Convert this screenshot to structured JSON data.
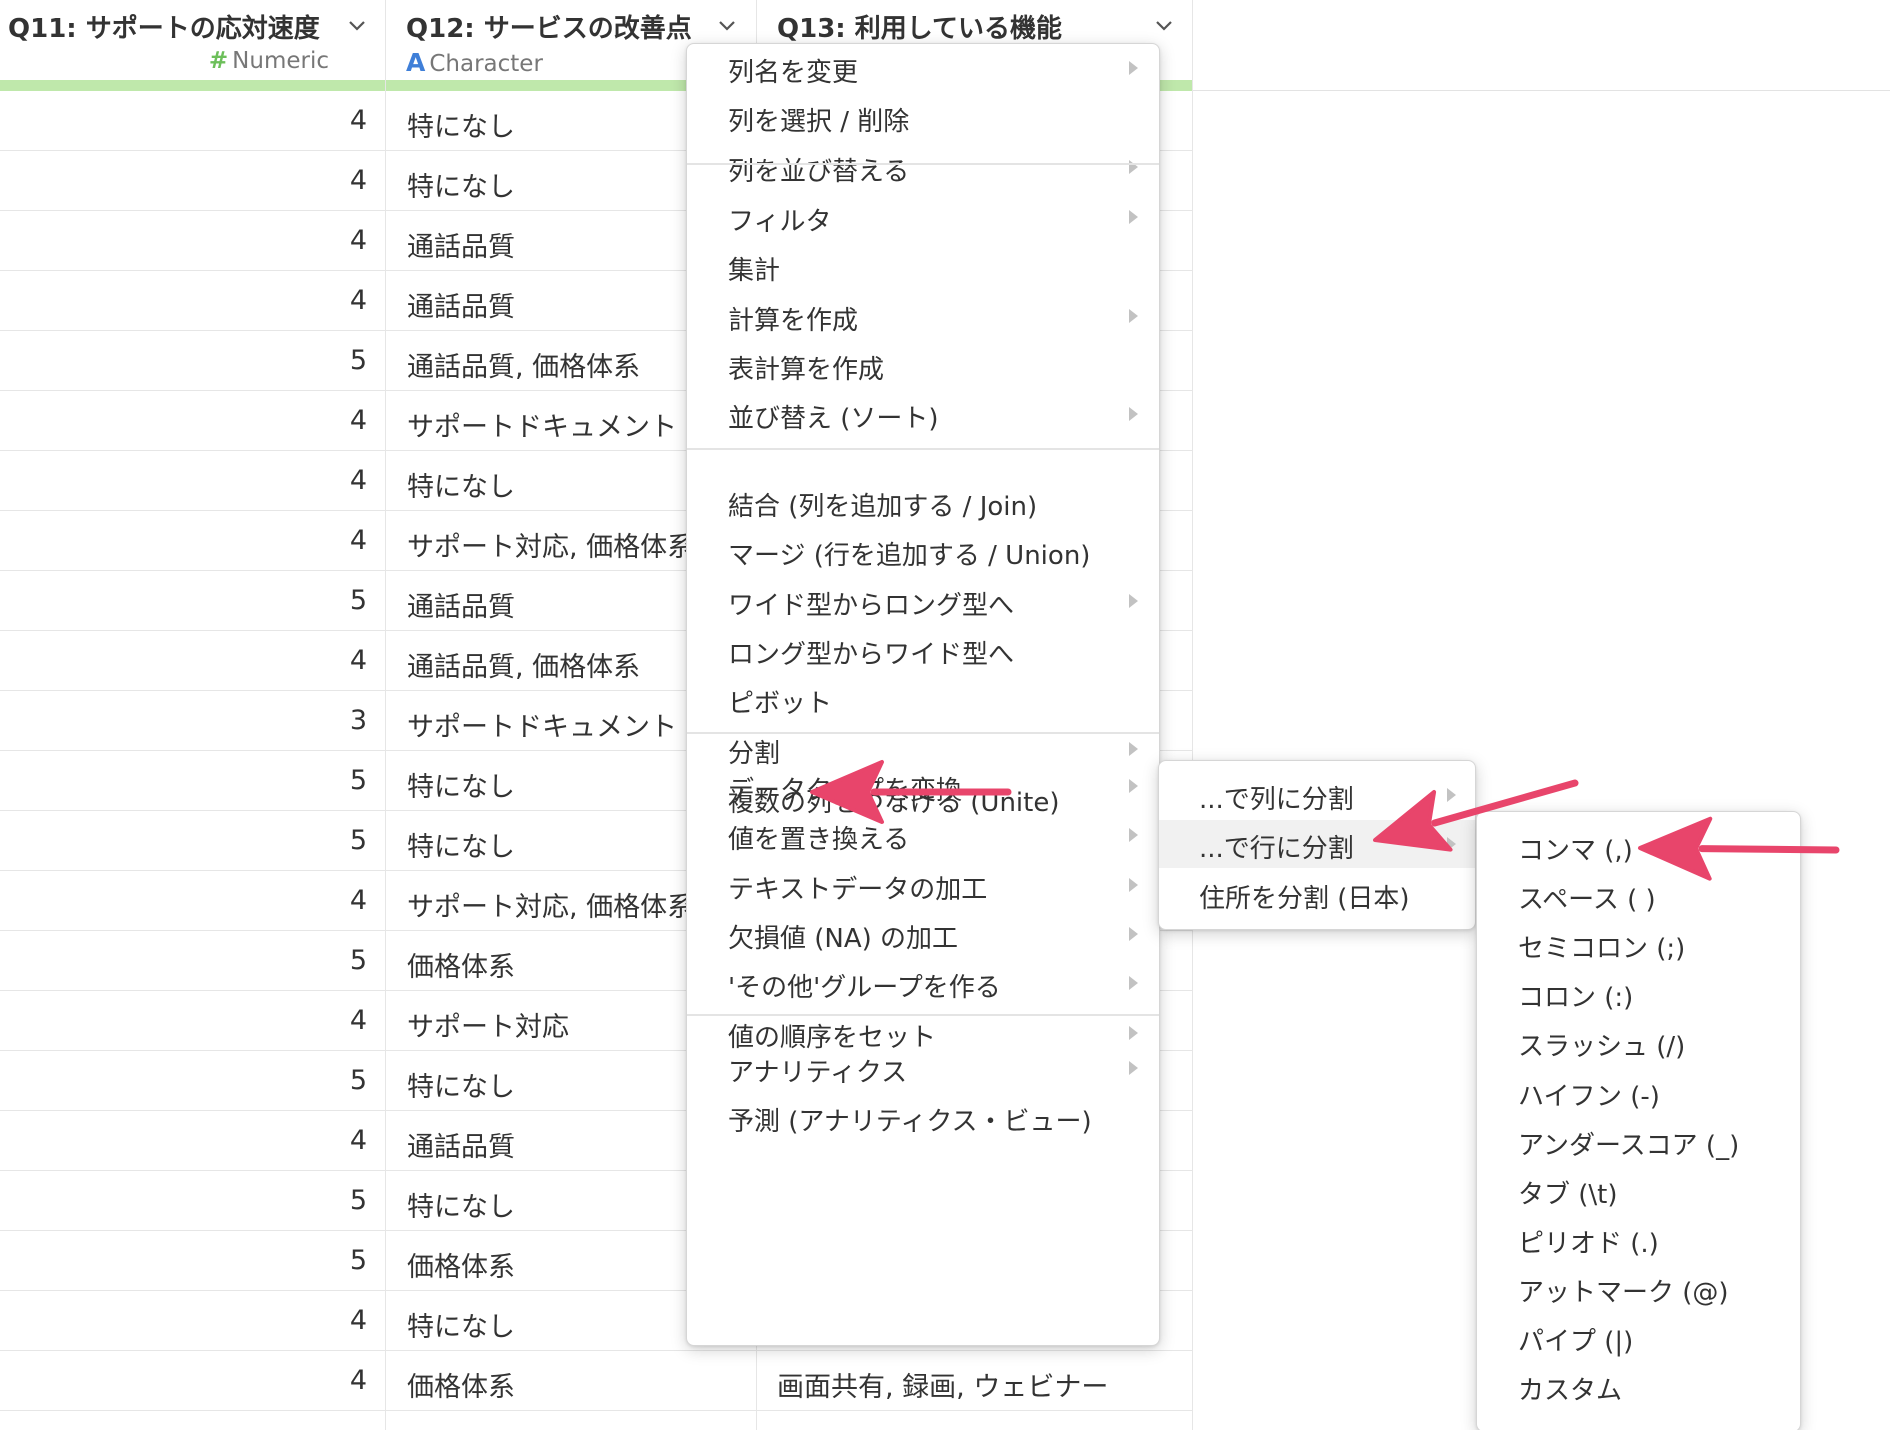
{
  "columns": {
    "q11": {
      "title": "Q11: サポートの応対速度",
      "type_icon": "#",
      "type_label": "Numeric"
    },
    "q12": {
      "title": "Q12: サービスの改善点",
      "type_icon": "A",
      "type_label": "Character"
    },
    "q13": {
      "title": "Q13: 利用している機能"
    }
  },
  "rows": [
    {
      "q11": "4",
      "q12": "特になし",
      "q13": ""
    },
    {
      "q11": "4",
      "q12": "特になし",
      "q13": ""
    },
    {
      "q11": "4",
      "q12": "通話品質",
      "q13": ""
    },
    {
      "q11": "4",
      "q12": "通話品質",
      "q13": ""
    },
    {
      "q11": "5",
      "q12": "通話品質, 価格体系",
      "q13": ""
    },
    {
      "q11": "4",
      "q12": "サポートドキュメント",
      "q13": ""
    },
    {
      "q11": "4",
      "q12": "特になし",
      "q13": ""
    },
    {
      "q11": "4",
      "q12": "サポート対応, 価格体系",
      "q13": ""
    },
    {
      "q11": "5",
      "q12": "通話品質",
      "q13": ""
    },
    {
      "q11": "4",
      "q12": "通話品質, 価格体系",
      "q13": ""
    },
    {
      "q11": "3",
      "q12": "サポートドキュメント",
      "q13": ""
    },
    {
      "q11": "5",
      "q12": "特になし",
      "q13": ""
    },
    {
      "q11": "5",
      "q12": "特になし",
      "q13": ""
    },
    {
      "q11": "4",
      "q12": "サポート対応, 価格体系",
      "q13": ""
    },
    {
      "q11": "5",
      "q12": "価格体系",
      "q13": ""
    },
    {
      "q11": "4",
      "q12": "サポート対応",
      "q13": ""
    },
    {
      "q11": "5",
      "q12": "特になし",
      "q13": ""
    },
    {
      "q11": "4",
      "q12": "通話品質",
      "q13": ""
    },
    {
      "q11": "5",
      "q12": "特になし",
      "q13": ""
    },
    {
      "q11": "5",
      "q12": "価格体系",
      "q13": ""
    },
    {
      "q11": "4",
      "q12": "特になし",
      "q13": ""
    },
    {
      "q11": "4",
      "q12": "価格体系",
      "q13": "画面共有, 録画, ウェビナー"
    }
  ],
  "context_menu": {
    "groups": [
      [
        {
          "label": "列名を変更",
          "submenu": true
        },
        {
          "label": "列を選択 / 削除",
          "submenu": false
        },
        {
          "label": "列を並び替える",
          "submenu": true
        }
      ],
      [
        {
          "label": "フィルタ",
          "submenu": true
        },
        {
          "label": "集計",
          "submenu": false
        },
        {
          "label": "計算を作成",
          "submenu": true
        },
        {
          "label": "表計算を作成",
          "submenu": false
        },
        {
          "label": "並び替え (ソート)",
          "submenu": true
        }
      ],
      [
        {
          "label": "結合 (列を追加する / Join)",
          "submenu": false
        },
        {
          "label": "マージ (行を追加する / Union)",
          "submenu": false
        },
        {
          "label": "ワイド型からロング型へ",
          "submenu": true
        },
        {
          "label": "ロング型からワイド型へ",
          "submenu": false
        },
        {
          "label": "ピボット",
          "submenu": false
        },
        {
          "label": "分割",
          "submenu": true
        },
        {
          "label": "複数の列をつなげる (Unite)",
          "submenu": false
        }
      ],
      [
        {
          "label": "データタイプを変換",
          "submenu": true
        },
        {
          "label": "値を置き換える",
          "submenu": true
        },
        {
          "label": "テキストデータの加工",
          "submenu": true
        },
        {
          "label": "欠損値 (NA) の加工",
          "submenu": true
        },
        {
          "label": "'その他'グループを作る",
          "submenu": true
        },
        {
          "label": "値の順序をセット",
          "submenu": true
        }
      ],
      [
        {
          "label": "アナリティクス",
          "submenu": true
        },
        {
          "label": "予測 (アナリティクス・ビュー)",
          "submenu": false
        }
      ]
    ]
  },
  "split_submenu": {
    "items": [
      {
        "label": "...で列に分割",
        "submenu": true,
        "highlighted": false
      },
      {
        "label": "...で行に分割",
        "submenu": true,
        "highlighted": true
      },
      {
        "label": "住所を分割 (日本)",
        "submenu": false,
        "highlighted": false
      }
    ]
  },
  "delimiter_submenu": {
    "items": [
      "コンマ (,)",
      "スペース ( )",
      "セミコロン (;)",
      "コロン (:)",
      "スラッシュ (/)",
      "ハイフン (-)",
      "アンダースコア (_)",
      "タブ (\\t)",
      "ピリオド (.)",
      "アットマーク (@)",
      "パイプ (|)",
      "カスタム"
    ]
  },
  "colors": {
    "header_strip": "#bfe8ab",
    "numeric_icon": "#6cbf5a",
    "character_icon": "#3f7fd8",
    "annotation_arrow": "#e8456b",
    "highlight_row": "#f1f1f1"
  }
}
